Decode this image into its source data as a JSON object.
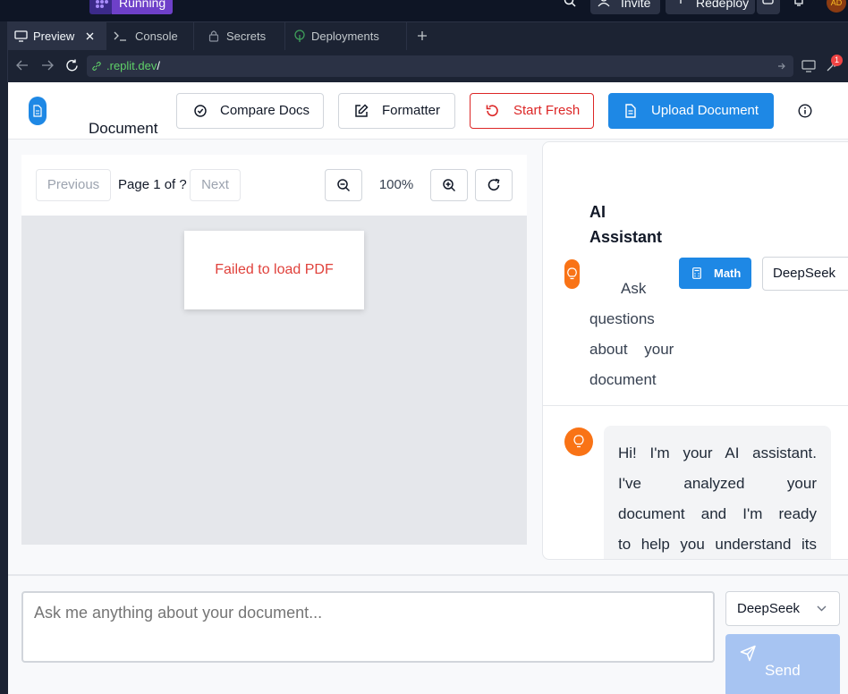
{
  "topbar": {
    "status": "Running",
    "invite_label": "Invite",
    "redeploy_label": "Redeploy",
    "avatar_initials": "AD"
  },
  "tabs": [
    {
      "label": "Preview",
      "active": true
    },
    {
      "label": "Console",
      "active": false
    },
    {
      "label": "Secrets",
      "active": false
    },
    {
      "label": "Deployments",
      "active": false
    }
  ],
  "url": {
    "host": ".replit.dev",
    "path": "/"
  },
  "notification_count": "1",
  "header": {
    "title": "Document",
    "compare_docs": "Compare Docs",
    "formatter": "Formatter",
    "start_fresh": "Start Fresh",
    "upload_document": "Upload Document"
  },
  "viewer": {
    "previous": "Previous",
    "page_info": "Page 1 of ?",
    "next": "Next",
    "zoom": "100%",
    "error": "Failed to load PDF"
  },
  "ai": {
    "title_line1": "AI",
    "title_line2": "Assistant",
    "subtitle_lines": [
      "Ask",
      "questions",
      "about your",
      "document"
    ],
    "math_label": "Math",
    "model": "DeepSeek",
    "message_lines": [
      "Hi! I'm your AI assistant.",
      "I've analyzed your",
      "document and I'm ready",
      "to help you understand its"
    ]
  },
  "composer": {
    "placeholder": "Ask me anything about your document...",
    "model": "DeepSeek",
    "send_label": "Send"
  },
  "colors": {
    "primary": "#1e88e5",
    "danger": "#dc2626",
    "accent_orange": "#f97316",
    "send_disabled": "#a7c4f2"
  }
}
